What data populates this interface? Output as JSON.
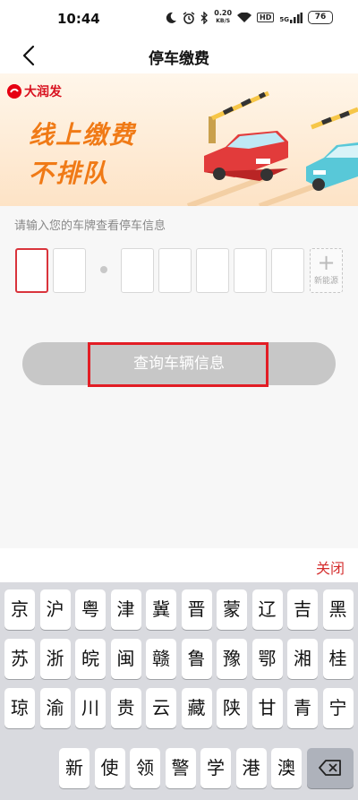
{
  "status_bar": {
    "time": "10:44",
    "net_speed_value": "0.20",
    "net_speed_unit": "KB/S",
    "hd_label": "HD",
    "network_label": "5G",
    "battery_level": "76",
    "icons": [
      "moon-icon",
      "alarm-icon",
      "bluetooth-icon",
      "wifi-icon",
      "signal-icon",
      "battery-icon"
    ]
  },
  "header": {
    "title": "停车缴费",
    "back_icon": "chevron-left-icon"
  },
  "banner": {
    "brand_name": "大润发",
    "slogan_line1": "线上缴费",
    "slogan_line2": "不排队",
    "slogan_color": "#f07a16",
    "brand_color": "#d8101e"
  },
  "form": {
    "prompt": "请输入您的车牌查看停车信息",
    "plate_slots": [
      "",
      "",
      "",
      "",
      "",
      "",
      ""
    ],
    "new_energy_label": "新能源",
    "new_energy_icon": "plus-icon",
    "query_button_label": "查询车辆信息",
    "active_border_color": "#d9343c"
  },
  "keyboard": {
    "close_label": "关闭",
    "rows": [
      [
        "京",
        "沪",
        "粤",
        "津",
        "冀",
        "晋",
        "蒙",
        "辽",
        "吉",
        "黑"
      ],
      [
        "苏",
        "浙",
        "皖",
        "闽",
        "赣",
        "鲁",
        "豫",
        "鄂",
        "湘",
        "桂"
      ],
      [
        "琼",
        "渝",
        "川",
        "贵",
        "云",
        "藏",
        "陕",
        "甘",
        "青",
        "宁"
      ],
      [
        "新",
        "使",
        "领",
        "警",
        "学",
        "港",
        "澳"
      ]
    ],
    "delete_icon": "backspace-icon"
  }
}
